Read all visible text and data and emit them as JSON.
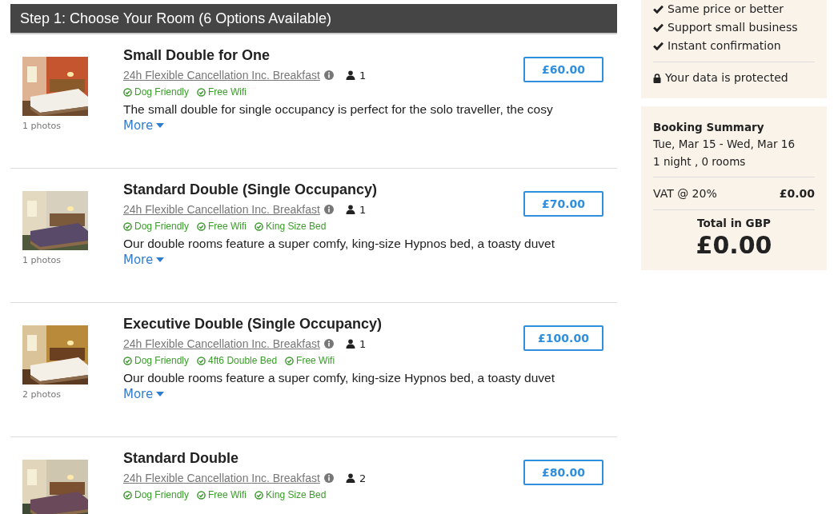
{
  "step_header": "Step 1: Choose Your Room (6 Options Available)",
  "rooms": [
    {
      "title": "Small Double for One",
      "photos": "1 photos",
      "rate": "24h Flexible Cancellation Inc. Breakfast",
      "guests": "1",
      "features": [
        "Dog Friendly",
        "Free Wifi"
      ],
      "description": "The small double for single occupancy is perfect for the solo traveller, the cosy",
      "more": "More",
      "price": "£60.00"
    },
    {
      "title": "Standard Double (Single Occupancy)",
      "photos": "1 photos",
      "rate": "24h Flexible Cancellation Inc. Breakfast",
      "guests": "1",
      "features": [
        "Dog Friendly",
        "Free Wifi",
        "King Size Bed"
      ],
      "description": "Our double rooms feature a super comfy, king-size Hypnos bed, a toasty duvet",
      "more": "More",
      "price": "£70.00"
    },
    {
      "title": "Executive Double (Single Occupancy)",
      "photos": "2 photos",
      "rate": "24h Flexible Cancellation Inc. Breakfast",
      "guests": "1",
      "features": [
        "Dog Friendly",
        "4ft6 Double Bed",
        "Free Wifi"
      ],
      "description": "Our double rooms feature a super comfy, king-size Hypnos bed, a toasty duvet",
      "more": "More",
      "price": "£100.00"
    },
    {
      "title": "Standard Double",
      "rate": "24h Flexible Cancellation Inc. Breakfast",
      "guests": "2",
      "features": [
        "Dog Friendly",
        "Free Wifi",
        "King Size Bed"
      ],
      "price": "£80.00"
    }
  ],
  "sidebar": {
    "benefits": [
      "Same price or better",
      "Support small business",
      "Instant confirmation"
    ],
    "protected": "Your data is protected",
    "summary": {
      "title": "Booking Summary",
      "dates": "Tue, Mar 15 - Wed, Mar 16",
      "stay": "1 night , 0 rooms",
      "vat_label": "VAT @ 20%",
      "vat_value": "£0.00",
      "total_label": "Total in GBP",
      "total_value": "£0.00"
    }
  }
}
